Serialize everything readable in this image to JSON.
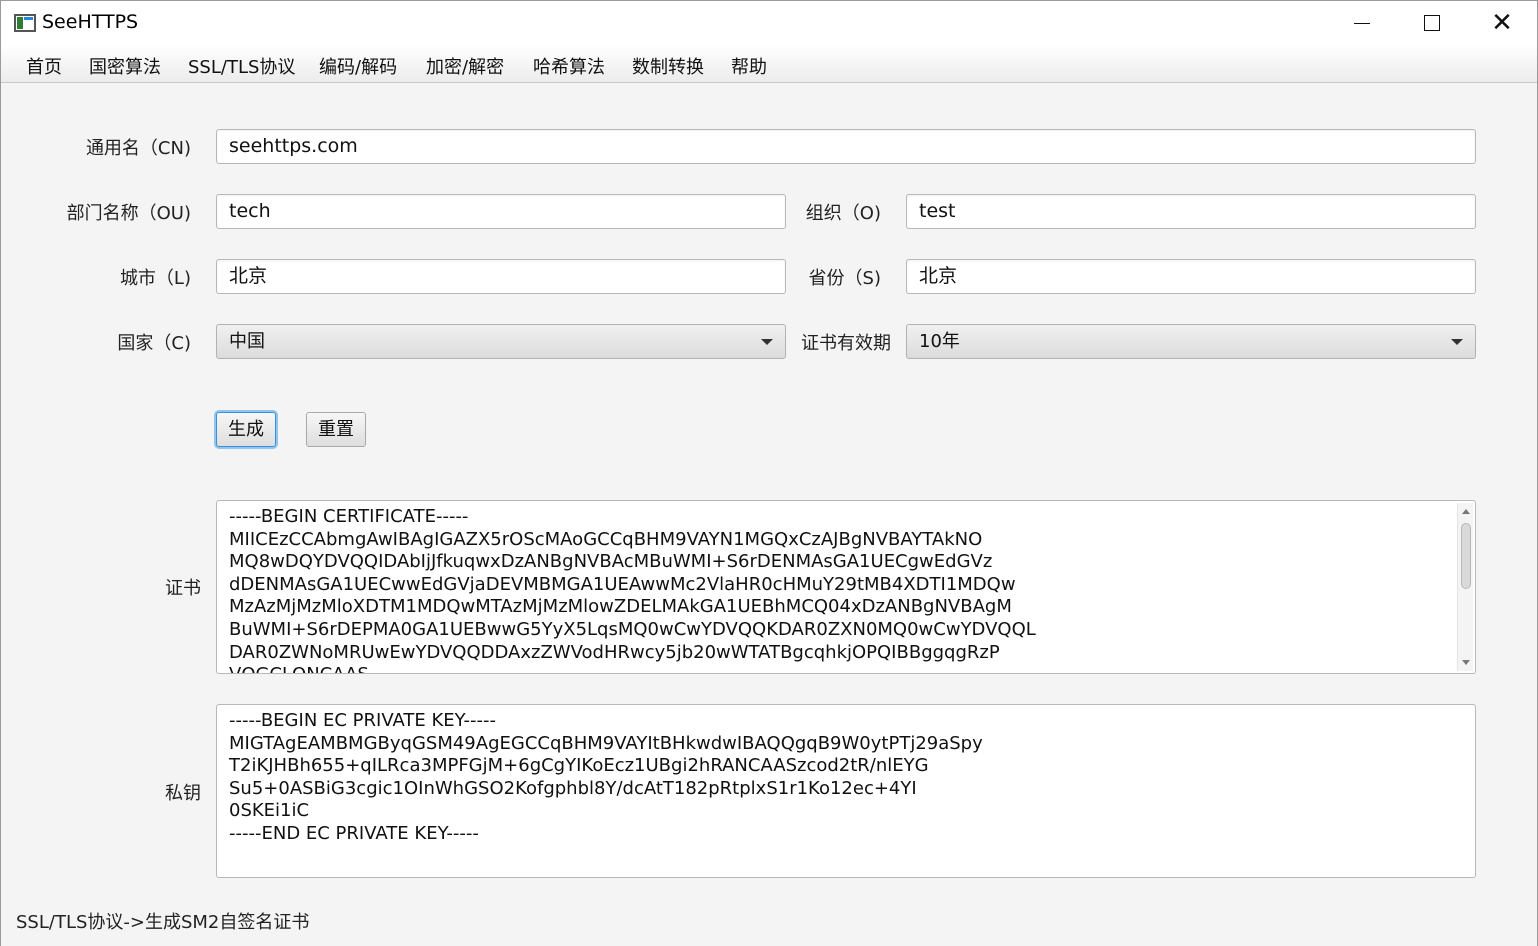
{
  "window": {
    "title": "SeeHTTPS",
    "controls": {
      "minimize": "",
      "maximize": "",
      "close": "✕"
    }
  },
  "menu": [
    "首页",
    "国密算法",
    "SSL/TLS协议",
    "编码/解码",
    "加密/解密",
    "哈希算法",
    "数制转换",
    "帮助"
  ],
  "form": {
    "cn": {
      "label": "通用名（CN)",
      "value": "seehttps.com"
    },
    "ou": {
      "label": "部门名称（OU)",
      "value": "tech"
    },
    "o": {
      "label": "组织（O)",
      "value": "test"
    },
    "l": {
      "label": "城市（L)",
      "value": "北京"
    },
    "s": {
      "label": "省份（S)",
      "value": "北京"
    },
    "c": {
      "label": "国家（C)",
      "value": "中国"
    },
    "validity": {
      "label": "证书有效期",
      "value": "10年"
    }
  },
  "buttons": {
    "generate": "生成",
    "reset": "重置"
  },
  "certificate": {
    "label": "证书",
    "text": "-----BEGIN CERTIFICATE-----\nMIICEzCCAbmgAwIBAgIGAZX5rOScMAoGCCqBHM9VAYN1MGQxCzAJBgNVBAYTAkNO\nMQ8wDQYDVQQIDAbIjJfkuqwxDzANBgNVBAcMBuWMI+S6rDENMAsGA1UECgwEdGVz\ndDENMAsGA1UECwwEdGVjaDEVMBMGA1UEAwwMc2VlaHR0cHMuY29tMB4XDTI1MDQw\nMzAzMjMzMloXDTM1MDQwMTAzMjMzMlowZDELMAkGA1UEBhMCQ04xDzANBgNVBAgM\nBuWMI+S6rDEPMA0GA1UEBwwG5YyX5LqsMQ0wCwYDVQQKDAR0ZXN0MQ0wCwYDVQQL\nDAR0ZWNoMRUwEwYDVQQDDAxzZWVodHRwcy5jb20wWTATBgcqhkjOPQIBBggqgRzP\nVQGCLQNCAAS..."
  },
  "private_key": {
    "label": "私钥",
    "text": "-----BEGIN EC PRIVATE KEY-----\nMIGTAgEAMBMGByqGSM49AgEGCCqBHM9VAYItBHkwdwIBAQQgqB9W0ytPTj29aSpy\nT2iKJHBh655+qILRca3MPFGjM+6gCgYIKoEcz1UBgi2hRANCAASzcod2tR/nlEYG\nSu5+0ASBiG3cgic1OInWhGSO2Kofgphbl8Y/dcAtT182pRtplxS1r1Ko12ec+4YI\n0SKEi1iC\n-----END EC PRIVATE KEY-----"
  },
  "status_bar": "SSL/TLS协议->生成SM2自签名证书"
}
